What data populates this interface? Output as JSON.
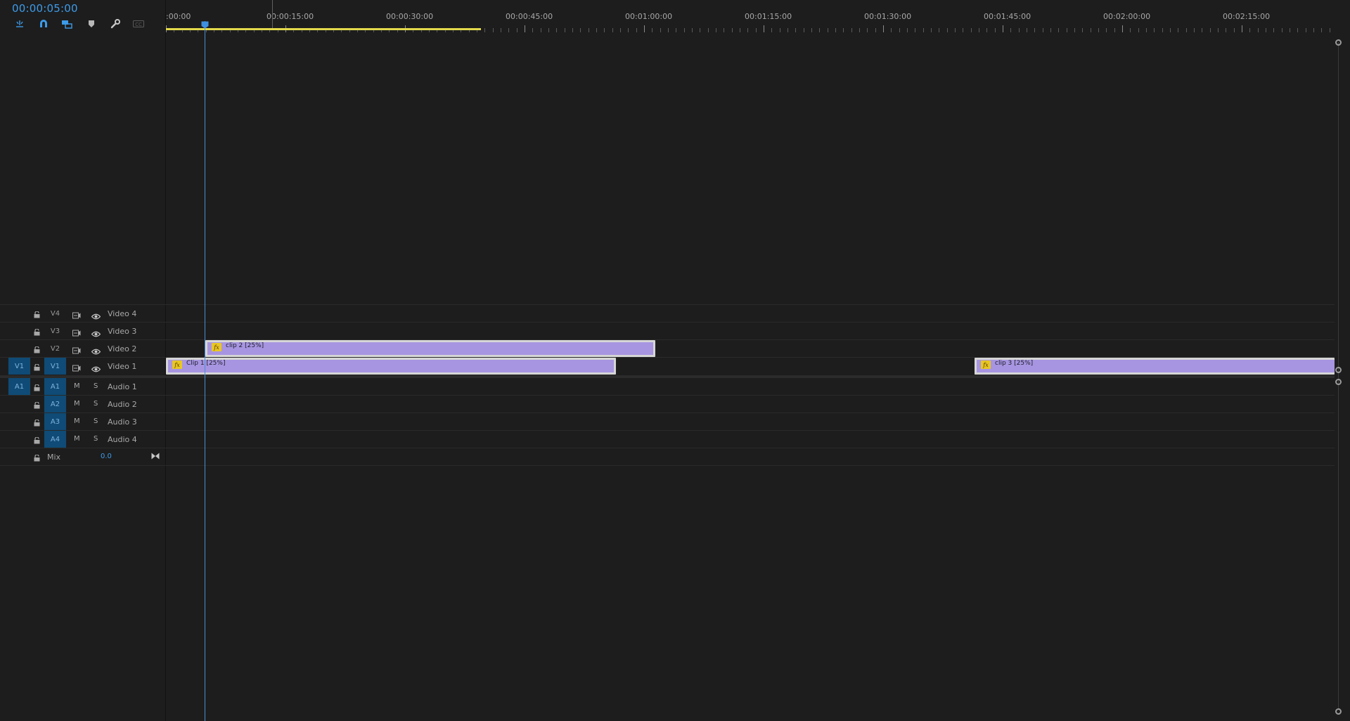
{
  "timecode": "00:00:05:00",
  "toolbar": {
    "icons": [
      "snap-nested-icon",
      "magnet-snap-icon",
      "linked-selection-icon",
      "add-marker-icon",
      "wrench-settings-icon",
      "captions-icon"
    ],
    "captions_label": "CC"
  },
  "ruler": {
    "labels": [
      ":00:00",
      "00:00:15:00",
      "00:00:30:00",
      "00:00:45:00",
      "00:01:00:00",
      "00:01:15:00",
      "00:01:30:00",
      "00:01:45:00",
      "00:02:00:00",
      "00:02:15:00"
    ]
  },
  "video_tracks": [
    {
      "id": "V4",
      "name": "Video 4",
      "source_patch": ""
    },
    {
      "id": "V3",
      "name": "Video 3",
      "source_patch": ""
    },
    {
      "id": "V2",
      "name": "Video 2",
      "source_patch": ""
    },
    {
      "id": "V1",
      "name": "Video 1",
      "source_patch": "V1"
    }
  ],
  "audio_tracks": [
    {
      "id": "A1",
      "name": "Audio 1",
      "source_patch": "A1",
      "mute": "M",
      "solo": "S"
    },
    {
      "id": "A2",
      "name": "Audio 2",
      "source_patch": "",
      "mute": "M",
      "solo": "S"
    },
    {
      "id": "A3",
      "name": "Audio 3",
      "source_patch": "",
      "mute": "M",
      "solo": "S"
    },
    {
      "id": "A4",
      "name": "Audio 4",
      "source_patch": "",
      "mute": "M",
      "solo": "S"
    }
  ],
  "mix": {
    "label": "Mix",
    "value": "0.0"
  },
  "clips": [
    {
      "label": "clip 2 [25%]",
      "track": "V2",
      "fx": "fx"
    },
    {
      "label": "Clip 1 [25%]",
      "track": "V1",
      "fx": "fx"
    },
    {
      "label": "clip 3 [25%]",
      "track": "V1",
      "fx": "fx"
    }
  ],
  "colors": {
    "timecode": "#3d9be9",
    "clip": "#a795e1",
    "work_area": "#e3d94b",
    "patch_active": "#0f4b76"
  }
}
